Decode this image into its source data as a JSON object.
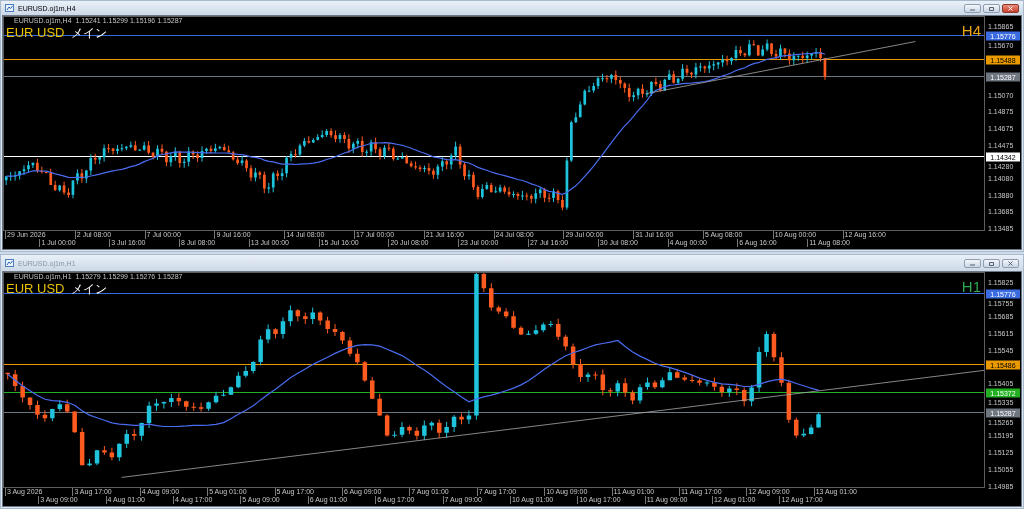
{
  "windows": [
    {
      "title": "EURUSD.oj1m,H4",
      "active": true,
      "info": "EURUSD.oj1m,H4  1.15241 1.15299 1.15196 1.15287",
      "symbol": "EUR USD",
      "label": "メイン",
      "period": "H4",
      "color": "#e8a317",
      "price_ticks": [
        "1.15865",
        "1.15670",
        "1.15070",
        "1.14875",
        "1.14675",
        "1.14475",
        "1.14280",
        "1.14080",
        "1.13880",
        "1.13685",
        "1.13485"
      ],
      "levels": [
        {
          "price": "1.15776",
          "color": "#3b6be0"
        },
        {
          "price": "1.15488",
          "color": "#e89a00"
        },
        {
          "price": "1.15287",
          "color": "#6e7780"
        },
        {
          "price": "1.14342",
          "color": "#ffffff"
        }
      ],
      "time_labels": [
        "29 Jun 2026",
        "1 Jul 00:00",
        "2 Jul 08:00",
        "3 Jul 16:00",
        "7 Jul 00:00",
        "8 Jul 08:00",
        "9 Jul 16:00",
        "13 Jul 00:00",
        "14 Jul 08:00",
        "15 Jul 16:00",
        "17 Jul 00:00",
        "20 Jul 08:00",
        "21 Jul 16:00",
        "23 Jul 00:00",
        "24 Jul 08:00",
        "27 Jul 16:00",
        "29 Jul 00:00",
        "30 Jul 08:00",
        "31 Jul 16:00",
        "4 Aug 00:00",
        "5 Aug 08:00",
        "6 Aug 16:00",
        "10 Aug 00:00",
        "11 Aug 08:00",
        "12 Aug 16:00"
      ]
    },
    {
      "title": "EURUSD.oj1m,H1",
      "active": false,
      "info": "EURUSD.oj1m,H1  1.15279 1.15299 1.15276 1.15287",
      "symbol": "EUR USD",
      "label": "メイン",
      "period": "H1",
      "color": "#2fa84f",
      "price_ticks": [
        "1.15825",
        "1.15755",
        "1.15685",
        "1.15615",
        "1.15545",
        "1.15405",
        "1.15335",
        "1.15265",
        "1.15195",
        "1.15125",
        "1.15055",
        "1.14985"
      ],
      "levels": [
        {
          "price": "1.15776",
          "color": "#3b6be0"
        },
        {
          "price": "1.15486",
          "color": "#e89a00"
        },
        {
          "price": "1.15372",
          "color": "#22b022"
        },
        {
          "price": "1.15287",
          "color": "#6e7780"
        }
      ],
      "time_labels": [
        "3 Aug 2026",
        "3 Aug 09:00",
        "3 Aug 17:00",
        "4 Aug 01:00",
        "4 Aug 09:00",
        "4 Aug 17:00",
        "5 Aug 01:00",
        "5 Aug 09:00",
        "5 Aug 17:00",
        "6 Aug 01:00",
        "6 Aug 09:00",
        "6 Aug 17:00",
        "7 Aug 01:00",
        "7 Aug 09:00",
        "7 Aug 17:00",
        "10 Aug 01:00",
        "10 Aug 09:00",
        "10 Aug 17:00",
        "11 Aug 01:00",
        "11 Aug 09:00",
        "11 Aug 17:00",
        "12 Aug 01:00",
        "12 Aug 09:00",
        "12 Aug 17:00",
        "13 Aug 01:00"
      ]
    }
  ]
}
